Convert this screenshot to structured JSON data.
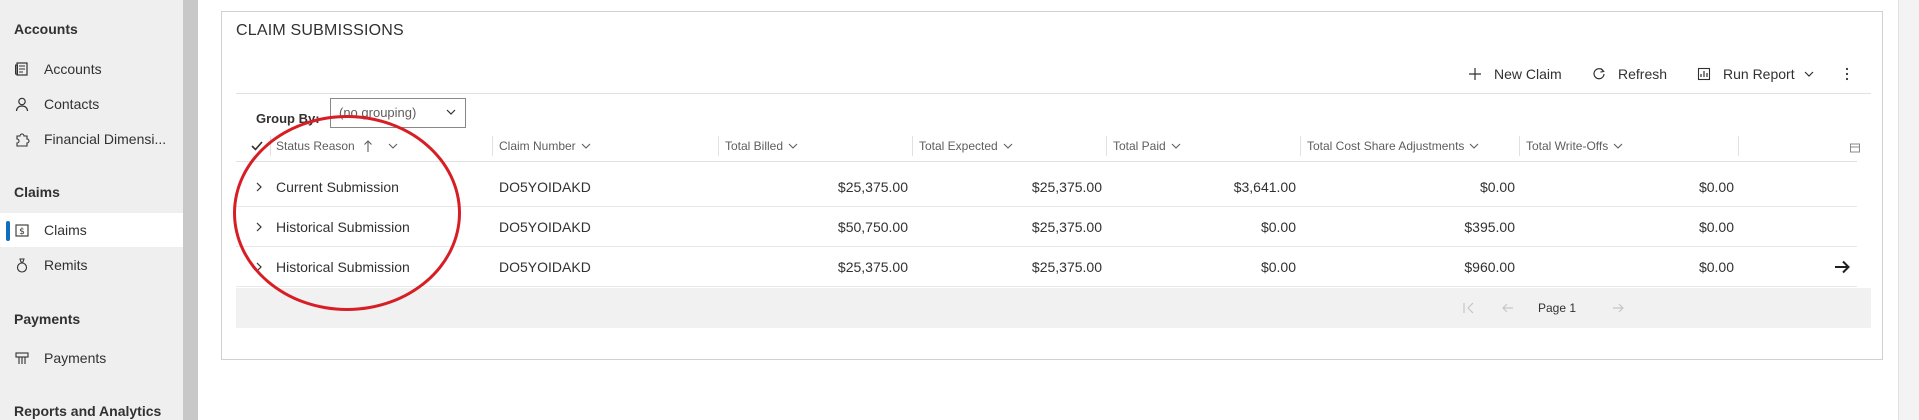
{
  "sidebar": {
    "sections": [
      {
        "title": "Accounts",
        "items": [
          {
            "label": "Accounts",
            "icon": "accounts-icon"
          },
          {
            "label": "Contacts",
            "icon": "contact-person-icon"
          },
          {
            "label": "Financial Dimensi...",
            "icon": "puzzle-icon"
          }
        ]
      },
      {
        "title": "Claims",
        "items": [
          {
            "label": "Claims",
            "icon": "claims-icon",
            "selected": true
          },
          {
            "label": "Remits",
            "icon": "money-bag-icon"
          }
        ]
      },
      {
        "title": "Payments",
        "items": [
          {
            "label": "Payments",
            "icon": "payments-icon"
          }
        ]
      },
      {
        "title": "Reports and Analytics",
        "items": []
      }
    ]
  },
  "panel": {
    "title": "CLAIM SUBMISSIONS",
    "commands": {
      "new_claim": "New Claim",
      "refresh": "Refresh",
      "run_report": "Run Report"
    },
    "group_by": {
      "label": "Group By:",
      "value": "(no grouping)"
    },
    "columns": [
      "Status Reason",
      "Claim Number",
      "Total Billed",
      "Total Expected",
      "Total Paid",
      "Total Cost Share Adjustments",
      "Total Write-Offs"
    ],
    "rows": [
      {
        "status": "Current Submission",
        "claim_number": "DO5YOIDAKD",
        "billed": "$25,375.00",
        "expected": "$25,375.00",
        "paid": "$3,641.00",
        "cost_share": "$0.00",
        "write_offs": "$0.00"
      },
      {
        "status": "Historical Submission",
        "claim_number": "DO5YOIDAKD",
        "billed": "$50,750.00",
        "expected": "$25,375.00",
        "paid": "$0.00",
        "cost_share": "$395.00",
        "write_offs": "$0.00"
      },
      {
        "status": "Historical Submission",
        "claim_number": "DO5YOIDAKD",
        "billed": "$25,375.00",
        "expected": "$25,375.00",
        "paid": "$0.00",
        "cost_share": "$960.00",
        "write_offs": "$0.00"
      }
    ],
    "pagination": {
      "page_label": "Page 1"
    }
  },
  "colors": {
    "accent": "#106ebe",
    "annotation": "#d71e25",
    "sidebar_bg": "#efefef"
  }
}
